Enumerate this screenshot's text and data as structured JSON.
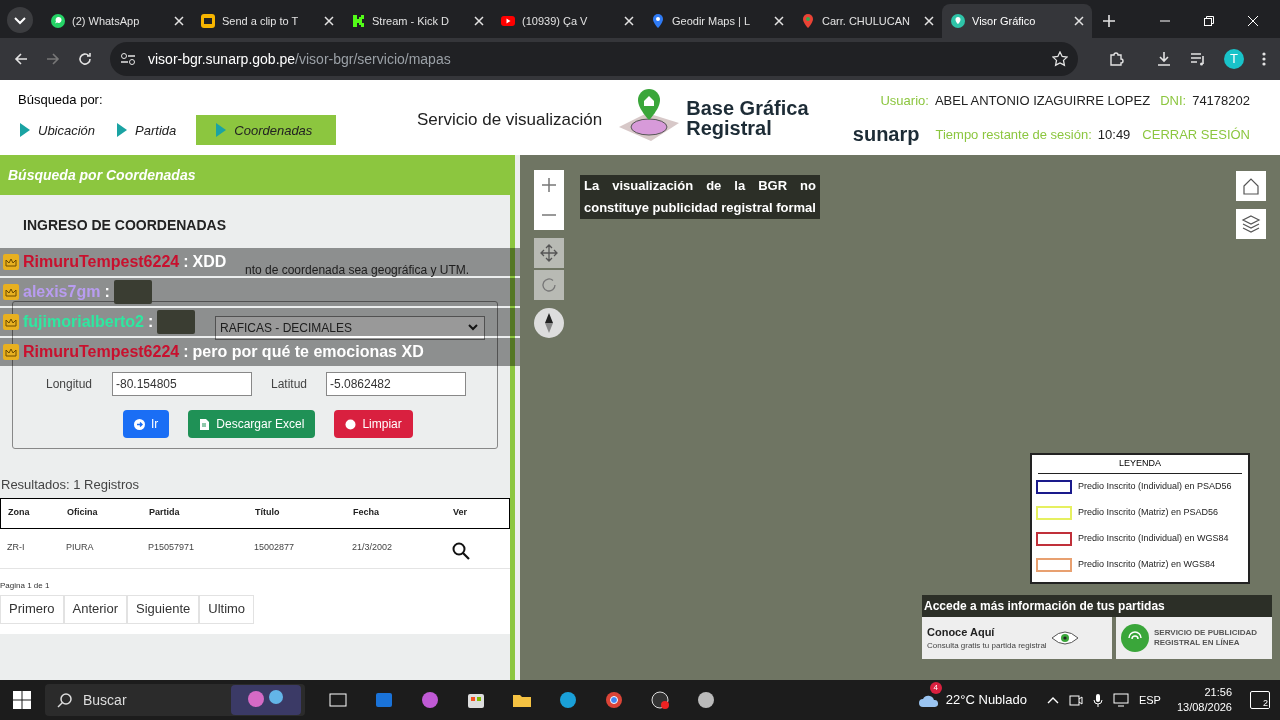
{
  "browser": {
    "tabs": [
      {
        "title": "(2) WhatsApp",
        "selected": false
      },
      {
        "title": "Send a clip to T",
        "selected": false
      },
      {
        "title": "Stream - Kick D",
        "selected": false
      },
      {
        "title": "(10939) Ça V",
        "selected": false
      },
      {
        "title": "Geodir Maps | L",
        "selected": false
      },
      {
        "title": "Carr. CHULUCAN",
        "selected": false
      },
      {
        "title": "Visor Gráfico",
        "selected": true
      }
    ],
    "address": {
      "host": "visor-bgr.sunarp.gob.pe",
      "path": "/visor-bgr/servicio/mapas"
    },
    "profile_initial": "T"
  },
  "header": {
    "search_by_label": "Búsqueda por:",
    "search_modes": [
      {
        "label": "Ubicación",
        "selected": false
      },
      {
        "label": "Partida",
        "selected": false
      },
      {
        "label": "Coordenadas",
        "selected": true
      }
    ],
    "service_title": "Servicio de visualización",
    "logo_line_1": "Base Gráfica",
    "logo_line_2": "Registral",
    "user_label": "Usuario:",
    "user_name": "ABEL ANTONIO IZAGUIRRE LOPEZ",
    "dni_label": "DNI:",
    "dni": "74178202",
    "brand": "sunarp",
    "session_label": "Tiempo restante de sesión:",
    "session_time": "10:49",
    "logout": "CERRAR SESIÓN"
  },
  "panel": {
    "title": "Búsqueda por Coordenadas",
    "section_title": "INGRESO DE COORDENADAS",
    "hint_visible": "nto de coordenada sea geográfica y UTM.",
    "select_value_visible": "RAFICAS - DECIMALES",
    "longitude_label": "Longitud",
    "longitude": "-80.154805",
    "latitude_label": "Latitud",
    "latitude": "-5.0862482",
    "buttons": [
      {
        "label": "Ir",
        "kind": "go"
      },
      {
        "label": "Descargar Excel",
        "kind": "excel"
      },
      {
        "label": "Limpiar",
        "kind": "clear"
      }
    ],
    "results_label": "Resultados: 1 Registros",
    "table": {
      "columns": [
        "Zona",
        "Oficina",
        "Partida",
        "Título",
        "Fecha",
        "Ver"
      ],
      "rows": [
        [
          "ZR-I",
          "PIURA",
          "P15057971",
          "15002877",
          "21/3/2002"
        ]
      ]
    },
    "page_info": "Pagina 1 de 1",
    "pager": [
      "Primero",
      "Anterior",
      "Siguiente",
      "Ultimo"
    ]
  },
  "map": {
    "notice": "La visualización de la BGR no constituye publicidad registral formal",
    "legend": {
      "title": "LEYENDA",
      "items": [
        {
          "label": "Predio Inscrito (Individual) en PSAD56",
          "color": "#1a1a8c"
        },
        {
          "label": "Predio Inscrito (Matriz) en PSAD56",
          "color": "#e6f060"
        },
        {
          "label": "Predio Inscrito (Individual) en WGS84",
          "color": "#c0303a"
        },
        {
          "label": "Predio Inscrito (Matriz) en WGS84",
          "color": "#e8a070"
        }
      ]
    },
    "banner": {
      "title": "Accede a más información de tus partidas",
      "left_title": "Conoce Aquí",
      "left_sub": "Consulta gratis tu partida registral",
      "right": "SERVICIO DE PUBLICIDAD REGISTRAL EN LÍNEA"
    }
  },
  "chat": [
    {
      "user": "RimuruTempest6224",
      "color": "#c8102e",
      "separator": ":",
      "message": "XDD",
      "emote": false
    },
    {
      "user": "alexis7gm",
      "color": "#b89cf0",
      "separator": ":",
      "emote": true
    },
    {
      "user": "fujimorialberto2",
      "color": "#2ee8a0",
      "separator": ":",
      "emote": true
    },
    {
      "user": "RimuruTempest6224",
      "color": "#c8102e",
      "separator": ":",
      "message": "pero por qué te emocionas XD",
      "emote": false
    }
  ],
  "taskbar": {
    "search": "Buscar",
    "weather_badge": "4",
    "weather": "22°C Nublado",
    "language": "ESP",
    "time": "21:56",
    "date": "13/08/2026",
    "notifications": "2"
  }
}
